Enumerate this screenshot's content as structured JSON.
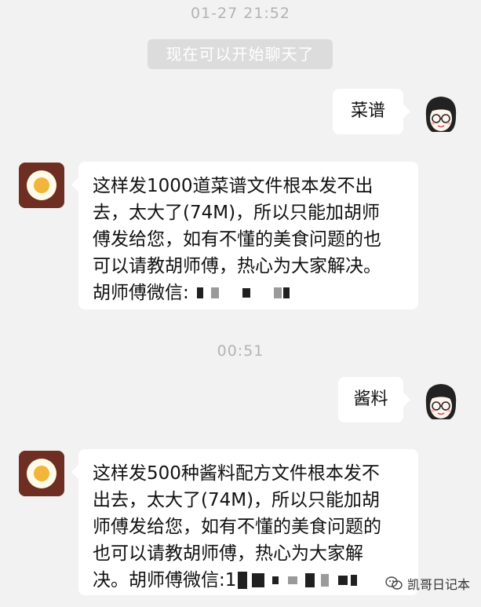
{
  "chat": {
    "timestamp_1": "01-27 21:52",
    "system_message": "现在可以开始聊天了",
    "msg_me_1": "菜谱",
    "msg_bot_1": {
      "line1": "这样发1000道菜谱文件根本发不出",
      "line2": "去，太大了(74M)，所以只能加胡师",
      "line3": "傅发给您，如有不懂的美食问题的也",
      "line4": "可以请教胡师傅，热心为大家解决。",
      "line5": "胡师傅微信:"
    },
    "timestamp_2": "00:51",
    "msg_me_2": "酱料",
    "msg_bot_2": {
      "line1": "这样发500种酱料配方文件根本发不",
      "line2": "出去，太大了(74M)，所以只能加胡",
      "line3": "师傅发给您，如有不懂的美食问题的",
      "line4": "也可以请教胡师傅，热心为大家解",
      "line5": "决。胡师傅微信:1"
    }
  },
  "watermark": {
    "text": "凯哥日记本",
    "icon": "wechat-icon"
  },
  "colors": {
    "background": "#f2f2f2",
    "bubble": "#ffffff",
    "timestamp": "#b3b3b3",
    "system_pill": "#dcdcdc"
  }
}
